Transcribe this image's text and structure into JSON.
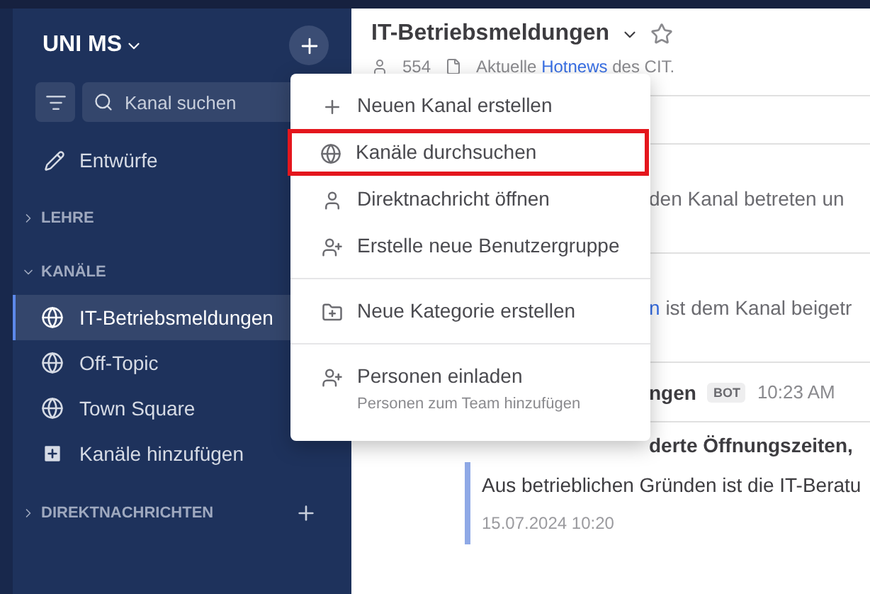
{
  "sidebar": {
    "team": "UNI MS",
    "search": {
      "placeholder": "Kanal suchen"
    },
    "drafts": "Entwürfe",
    "categories": [
      {
        "name": "LEHRE",
        "expanded": false,
        "addable": false
      },
      {
        "name": "KANÄLE",
        "expanded": true,
        "addable": false,
        "items": [
          {
            "label": "IT-Betriebsmeldungen",
            "kind": "channel",
            "selected": true
          },
          {
            "label": "Off-Topic",
            "kind": "channel",
            "selected": false
          },
          {
            "label": "Town Square",
            "kind": "channel",
            "selected": false
          },
          {
            "label": "Kanäle hinzufügen",
            "kind": "add",
            "selected": false
          }
        ]
      },
      {
        "name": "DIREKTNACHRICHTEN",
        "expanded": false,
        "addable": true
      }
    ]
  },
  "main": {
    "title": "IT-Betriebsmeldungen",
    "member_count": "554",
    "description": {
      "before": "Aktuelle",
      "link": "Hotnews",
      "after": "des CIT."
    },
    "rows": [
      {
        "kind": "system",
        "text": "den Kanal betreten un"
      },
      {
        "kind": "system",
        "link": "n",
        "text": "ist dem Kanal beigetr"
      },
      {
        "kind": "post_header",
        "author": "ngen",
        "badge": "BOT",
        "time": "10:23 AM"
      },
      {
        "kind": "title",
        "text": "derte Öffnungszeiten,"
      }
    ],
    "attachment": {
      "text": "Aus betrieblichen Gründen ist die IT-Beratu",
      "date": "15.07.2024 10:20"
    }
  },
  "menu": {
    "groups": [
      [
        {
          "label": "Neuen Kanal erstellen",
          "highlighted": false
        },
        {
          "label": "Kanäle durchsuchen",
          "highlighted": true
        },
        {
          "label": "Direktnachricht öffnen",
          "highlighted": false
        },
        {
          "label": "Erstelle neue Benutzergruppe",
          "highlighted": false
        }
      ],
      [
        {
          "label": "Neue Kategorie erstellen",
          "highlighted": false
        }
      ],
      [
        {
          "label": "Personen einladen",
          "subtitle": "Personen zum Team hinzufügen",
          "highlighted": false
        }
      ]
    ]
  }
}
